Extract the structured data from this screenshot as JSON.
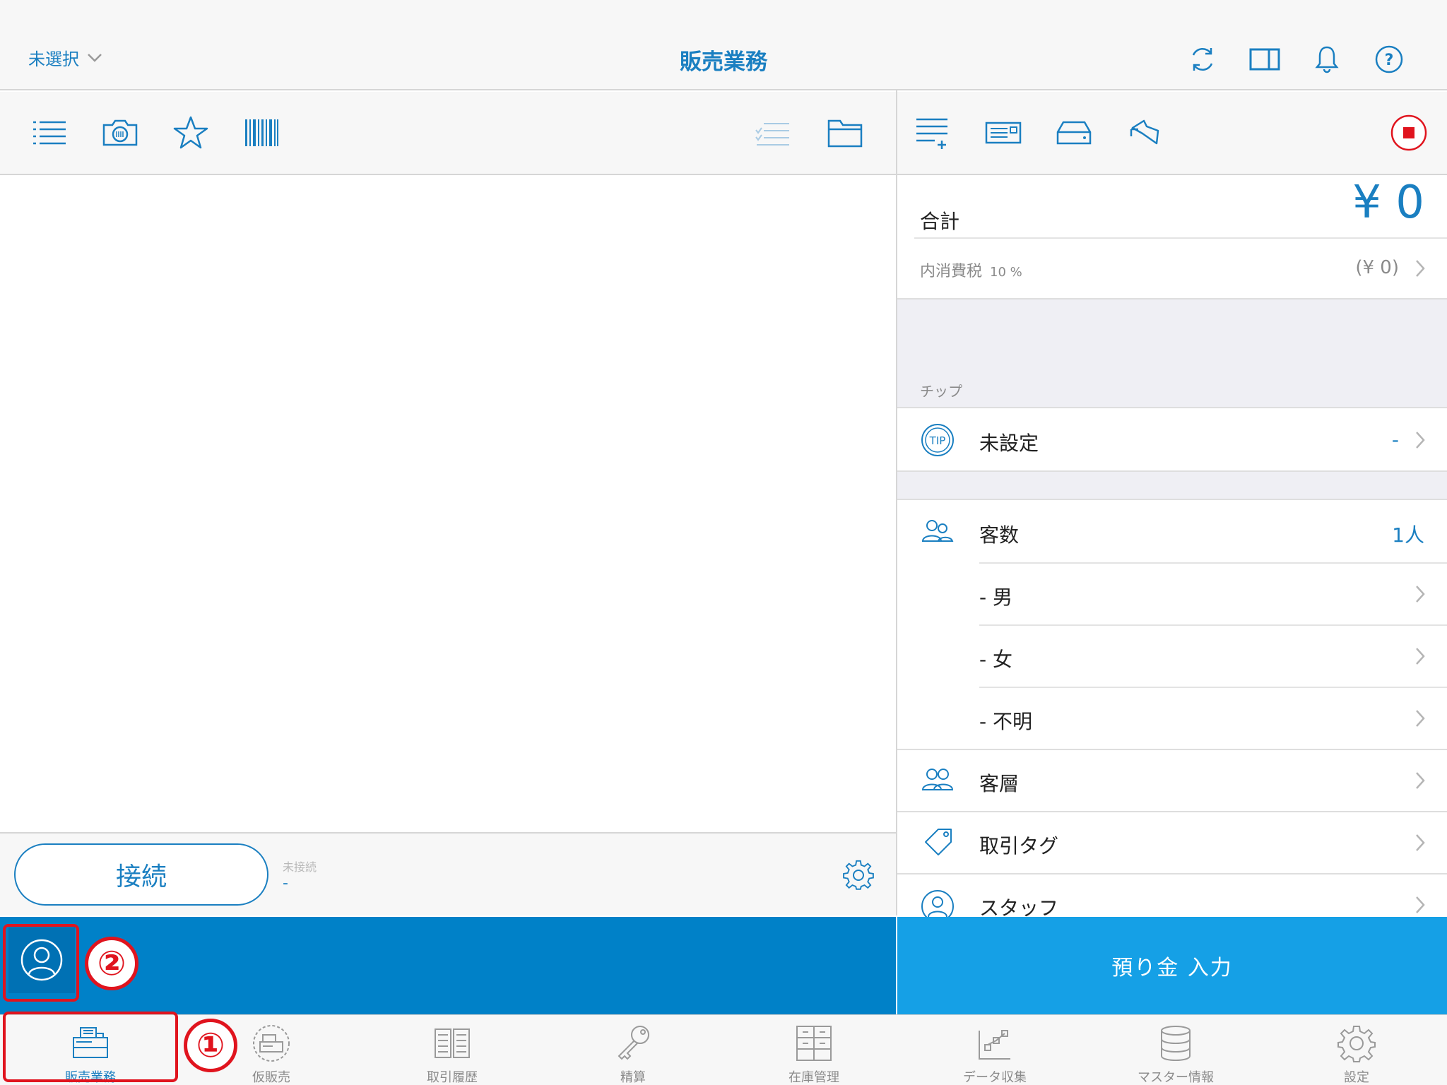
{
  "colors": {
    "accent": "#1a7fc1",
    "blue_bar": "#0081c8",
    "deposit_button": "#15a0e6",
    "marker": "#e0141e",
    "record_stop": "#e0141e"
  },
  "header": {
    "store_selector": "未選択",
    "title": "販売業務",
    "icons": [
      "sync-icon",
      "split-view-icon",
      "bell-icon",
      "help-icon"
    ]
  },
  "left_toolbar": {
    "icons": [
      "list-icon",
      "camera-icon",
      "star-icon",
      "barcode-icon",
      "checklist-icon",
      "folder-icon"
    ]
  },
  "right_toolbar": {
    "icons": [
      "add-line-icon",
      "receipt-printer-icon",
      "cash-drawer-icon",
      "return-icon",
      "stop-record-icon"
    ]
  },
  "connection": {
    "button_label": "接続",
    "status_label": "未接続",
    "status_value": "-"
  },
  "summary": {
    "total_label": "合計",
    "total_value": "¥ 0",
    "tax_label": "内消費税",
    "tax_rate": "10 %",
    "tax_value": "(¥ 0)",
    "tip_section_title": "チップ",
    "tip_label": "未設定",
    "tip_value": "-",
    "customers_label": "客数",
    "customers_value": "1人",
    "male_label": "- 男",
    "female_label": "- 女",
    "unknown_label": "- 不明",
    "segment_label": "客層",
    "tag_label": "取引タグ",
    "staff_label": "スタッフ"
  },
  "deposit_button": "預り金 入力",
  "markers": {
    "one": "①",
    "two": "②"
  },
  "tabs": [
    {
      "label": "販売業務",
      "icon": "register-icon",
      "active": true
    },
    {
      "label": "仮販売",
      "icon": "temp-sale-icon",
      "active": false
    },
    {
      "label": "取引履歴",
      "icon": "history-icon",
      "active": false
    },
    {
      "label": "精算",
      "icon": "key-icon",
      "active": false
    },
    {
      "label": "在庫管理",
      "icon": "inventory-icon",
      "active": false
    },
    {
      "label": "データ収集",
      "icon": "data-collection-icon",
      "active": false
    },
    {
      "label": "マスター情報",
      "icon": "database-icon",
      "active": false
    },
    {
      "label": "設定",
      "icon": "settings-icon",
      "active": false
    }
  ]
}
